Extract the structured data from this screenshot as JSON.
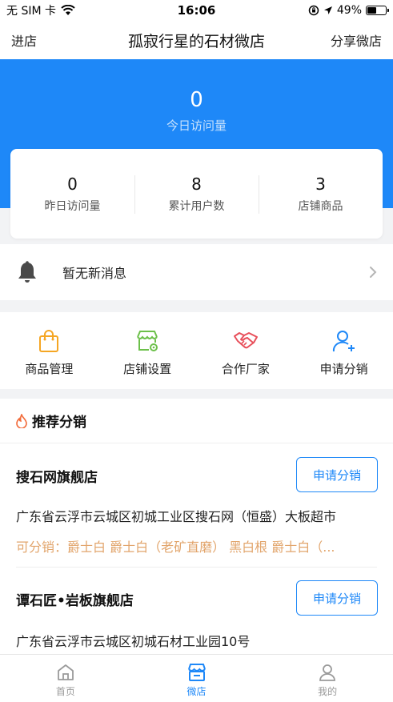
{
  "status_bar": {
    "carrier": "无 SIM 卡",
    "time": "16:06",
    "battery": "49%",
    "battery_level": 0.49
  },
  "nav": {
    "left": "进店",
    "title": "孤寂行星的石材微店",
    "right": "分享微店"
  },
  "today": {
    "value": "0",
    "label": "今日访问量"
  },
  "stats": [
    {
      "value": "0",
      "label": "昨日访问量"
    },
    {
      "value": "8",
      "label": "累计用户数"
    },
    {
      "value": "3",
      "label": "店铺商品"
    }
  ],
  "notice": {
    "text": "暂无新消息",
    "icon": "bell-icon"
  },
  "actions": [
    {
      "label": "商品管理",
      "icon": "shopping-bag-icon",
      "color": "#f5a623"
    },
    {
      "label": "店铺设置",
      "icon": "store-settings-icon",
      "color": "#6cc04a"
    },
    {
      "label": "合作厂家",
      "icon": "handshake-icon",
      "color": "#e8505b"
    },
    {
      "label": "申请分销",
      "icon": "add-user-icon",
      "color": "#1e88f8"
    }
  ],
  "recommend": {
    "title": "推荐分销",
    "icon": "flame-icon",
    "shops": [
      {
        "name": "搜石网旗舰店",
        "button": "申请分销",
        "address": "广东省云浮市云城区初城工业区搜石网（恒盛）大板超市",
        "distributable": "可分销：爵士白  爵士白（老矿直磨）  黑白根  爵士白（..."
      },
      {
        "name": "谭石匠•岩板旗舰店",
        "button": "申请分销",
        "address": "广东省云浮市云城区初城石材工业园10号"
      }
    ]
  },
  "tabbar": [
    {
      "label": "首页",
      "icon": "home-icon",
      "active": false
    },
    {
      "label": "微店",
      "icon": "store-icon",
      "active": true
    },
    {
      "label": "我的",
      "icon": "profile-icon",
      "active": false
    }
  ],
  "colors": {
    "primary": "#1e88f8",
    "accent_orange": "#e2a56c"
  }
}
